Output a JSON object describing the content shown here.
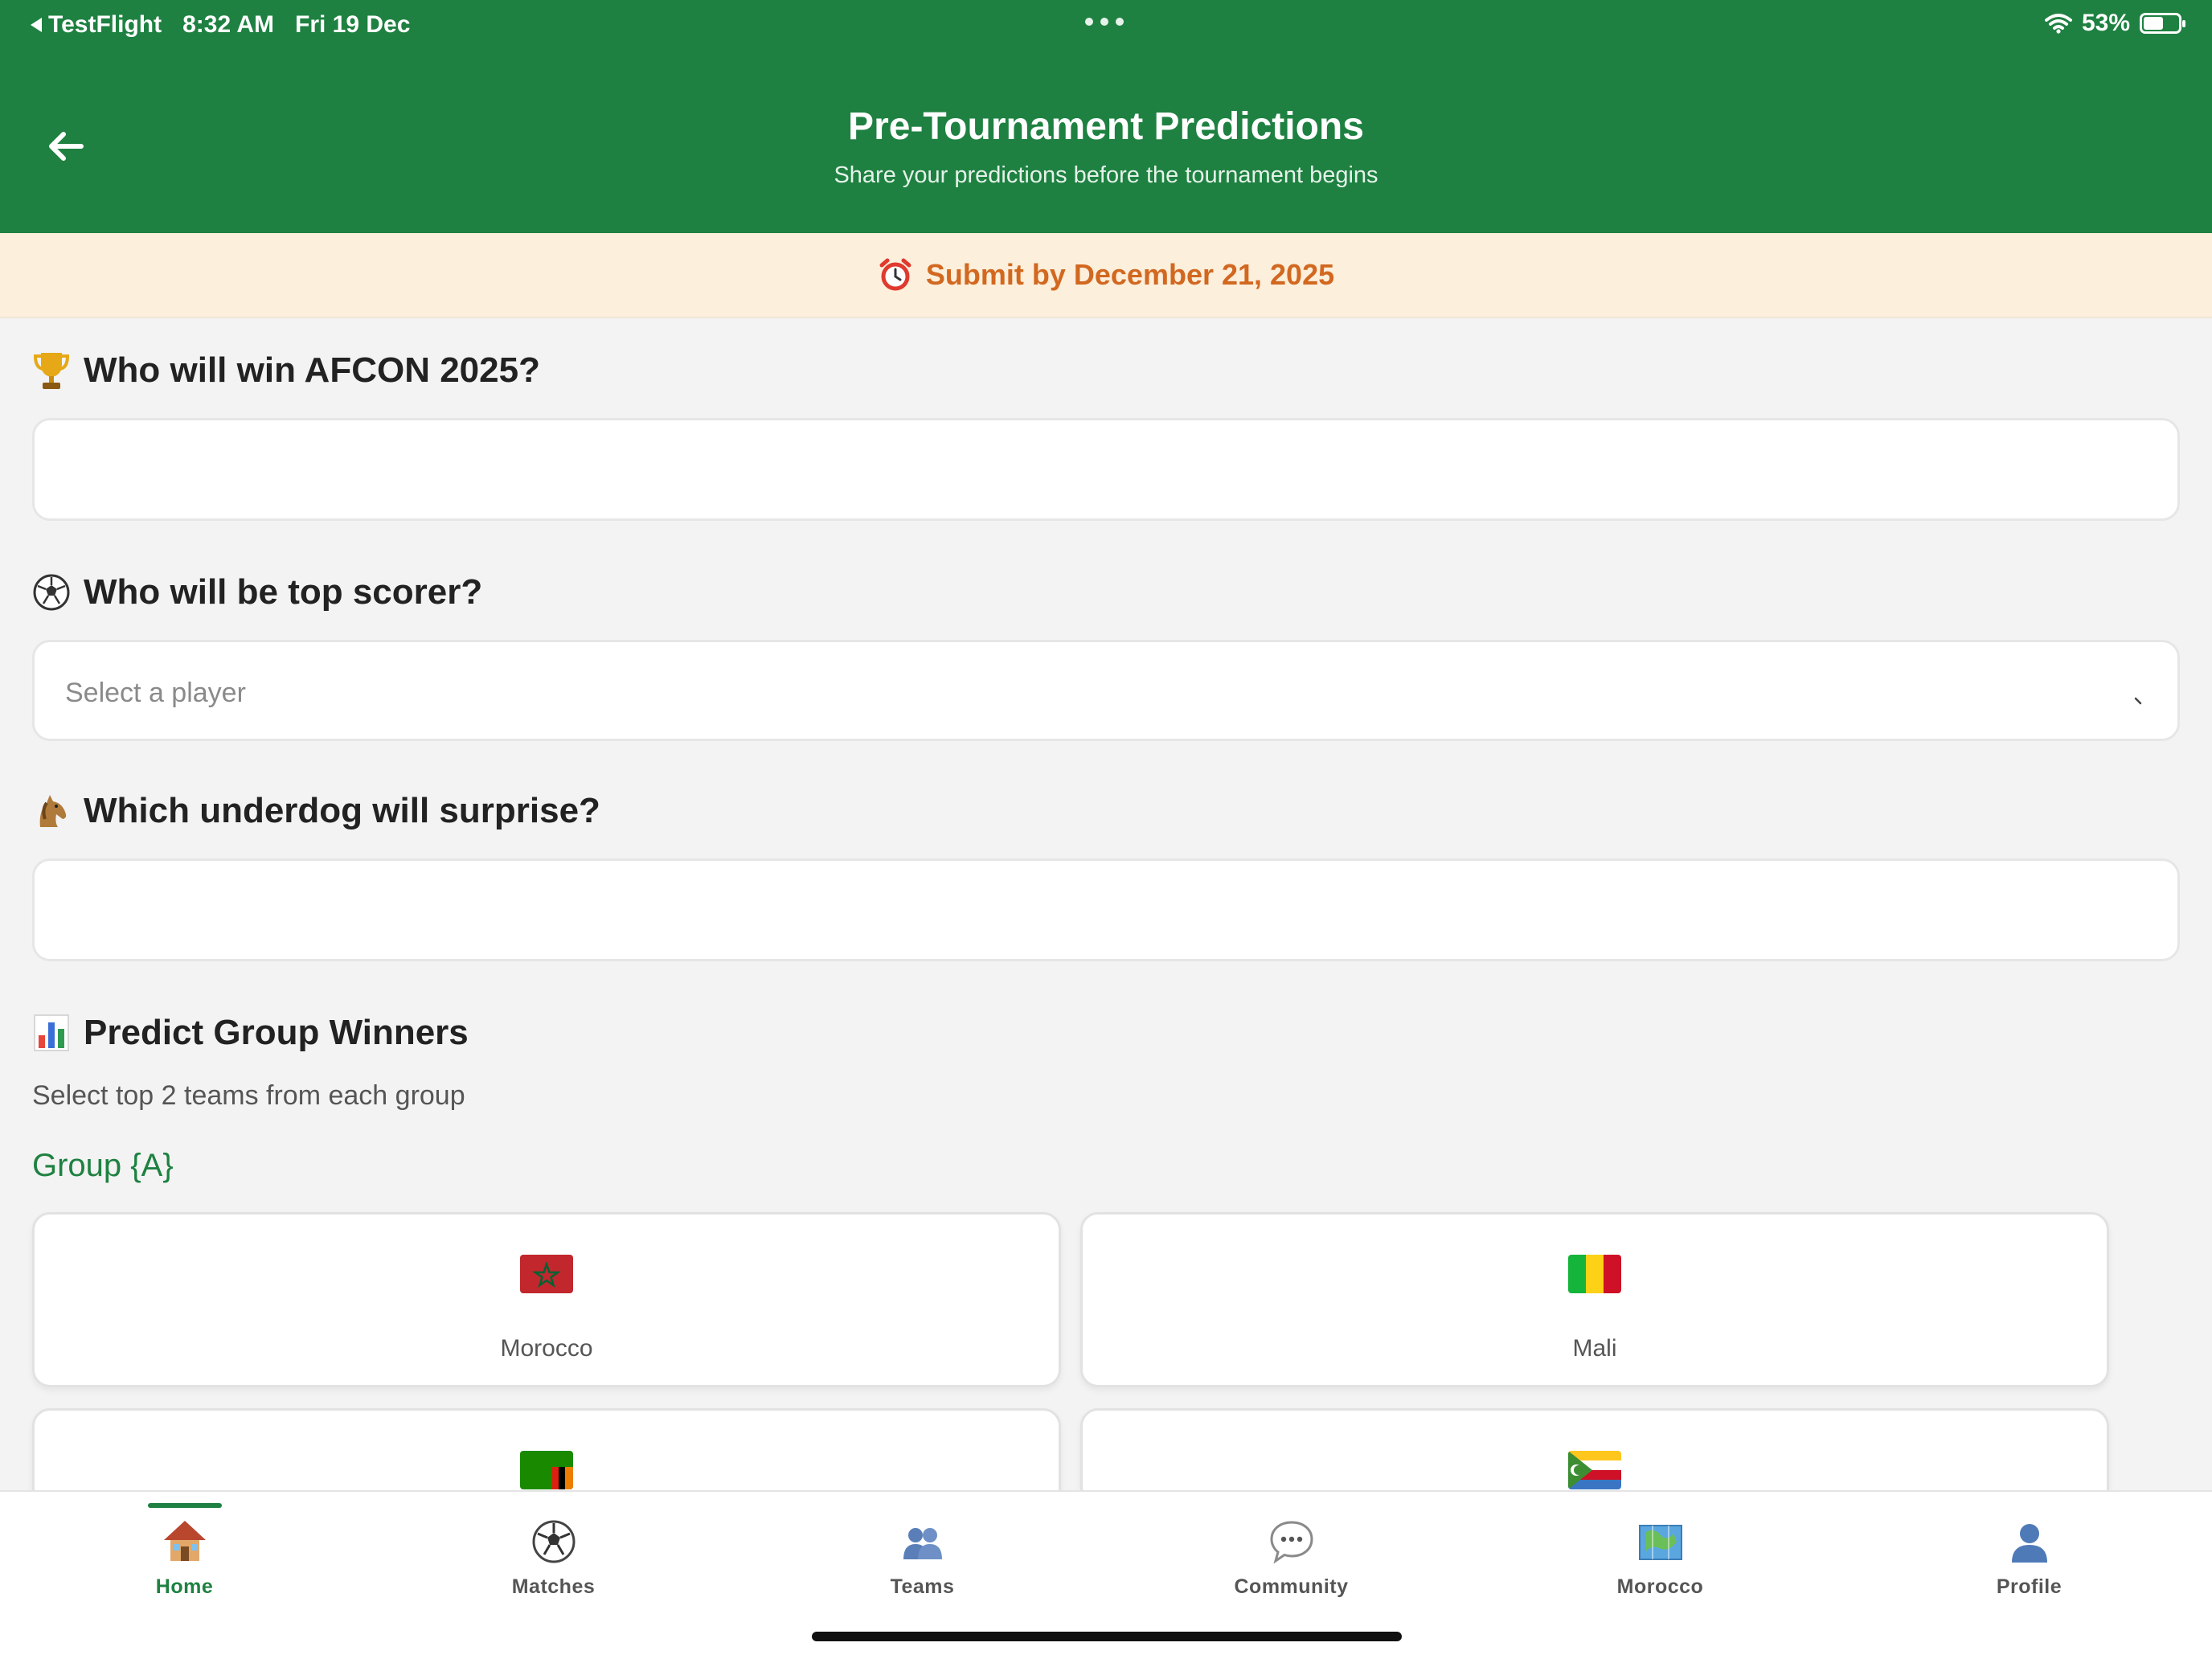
{
  "status_bar": {
    "back_app": "TestFlight",
    "time": "8:32 AM",
    "date": "Fri 19 Dec",
    "battery": "53%"
  },
  "header": {
    "title": "Pre-Tournament Predictions",
    "subtitle": "Share your predictions before the tournament begins",
    "back_icon": "arrow-left-icon"
  },
  "deadline": {
    "icon": "alarm-clock-icon",
    "text": "Submit by December 21, 2025"
  },
  "questions": {
    "winner": {
      "icon": "trophy-icon",
      "title": "Who will win AFCON 2025?",
      "value": ""
    },
    "top_scorer": {
      "icon": "soccer-ball-icon",
      "title": "Who will be top scorer?",
      "placeholder": "Select a player"
    },
    "underdog": {
      "icon": "horse-icon",
      "title": "Which underdog will surprise?",
      "value": ""
    }
  },
  "group_winners": {
    "icon": "bar-chart-icon",
    "title": "Predict Group Winners",
    "subtitle": "Select top 2 teams from each group",
    "group_label": "Group {A}",
    "teams": [
      {
        "name": "Morocco",
        "flag": "morocco-flag"
      },
      {
        "name": "Mali",
        "flag": "mali-flag"
      },
      {
        "name": "",
        "flag": "zambia-flag"
      },
      {
        "name": "",
        "flag": "comoros-flag"
      }
    ]
  },
  "tabs": [
    {
      "label": "Home",
      "icon": "house-icon",
      "active": true
    },
    {
      "label": "Matches",
      "icon": "soccer-ball-icon"
    },
    {
      "label": "Teams",
      "icon": "people-icon"
    },
    {
      "label": "Community",
      "icon": "speech-bubble-icon"
    },
    {
      "label": "Morocco",
      "icon": "map-icon"
    },
    {
      "label": "Profile",
      "icon": "person-icon"
    }
  ],
  "colors": {
    "brand_green": "#1e8141",
    "deadline_bg": "#fcefdc",
    "deadline_text": "#d26820",
    "page_bg": "#f3f3f3"
  }
}
